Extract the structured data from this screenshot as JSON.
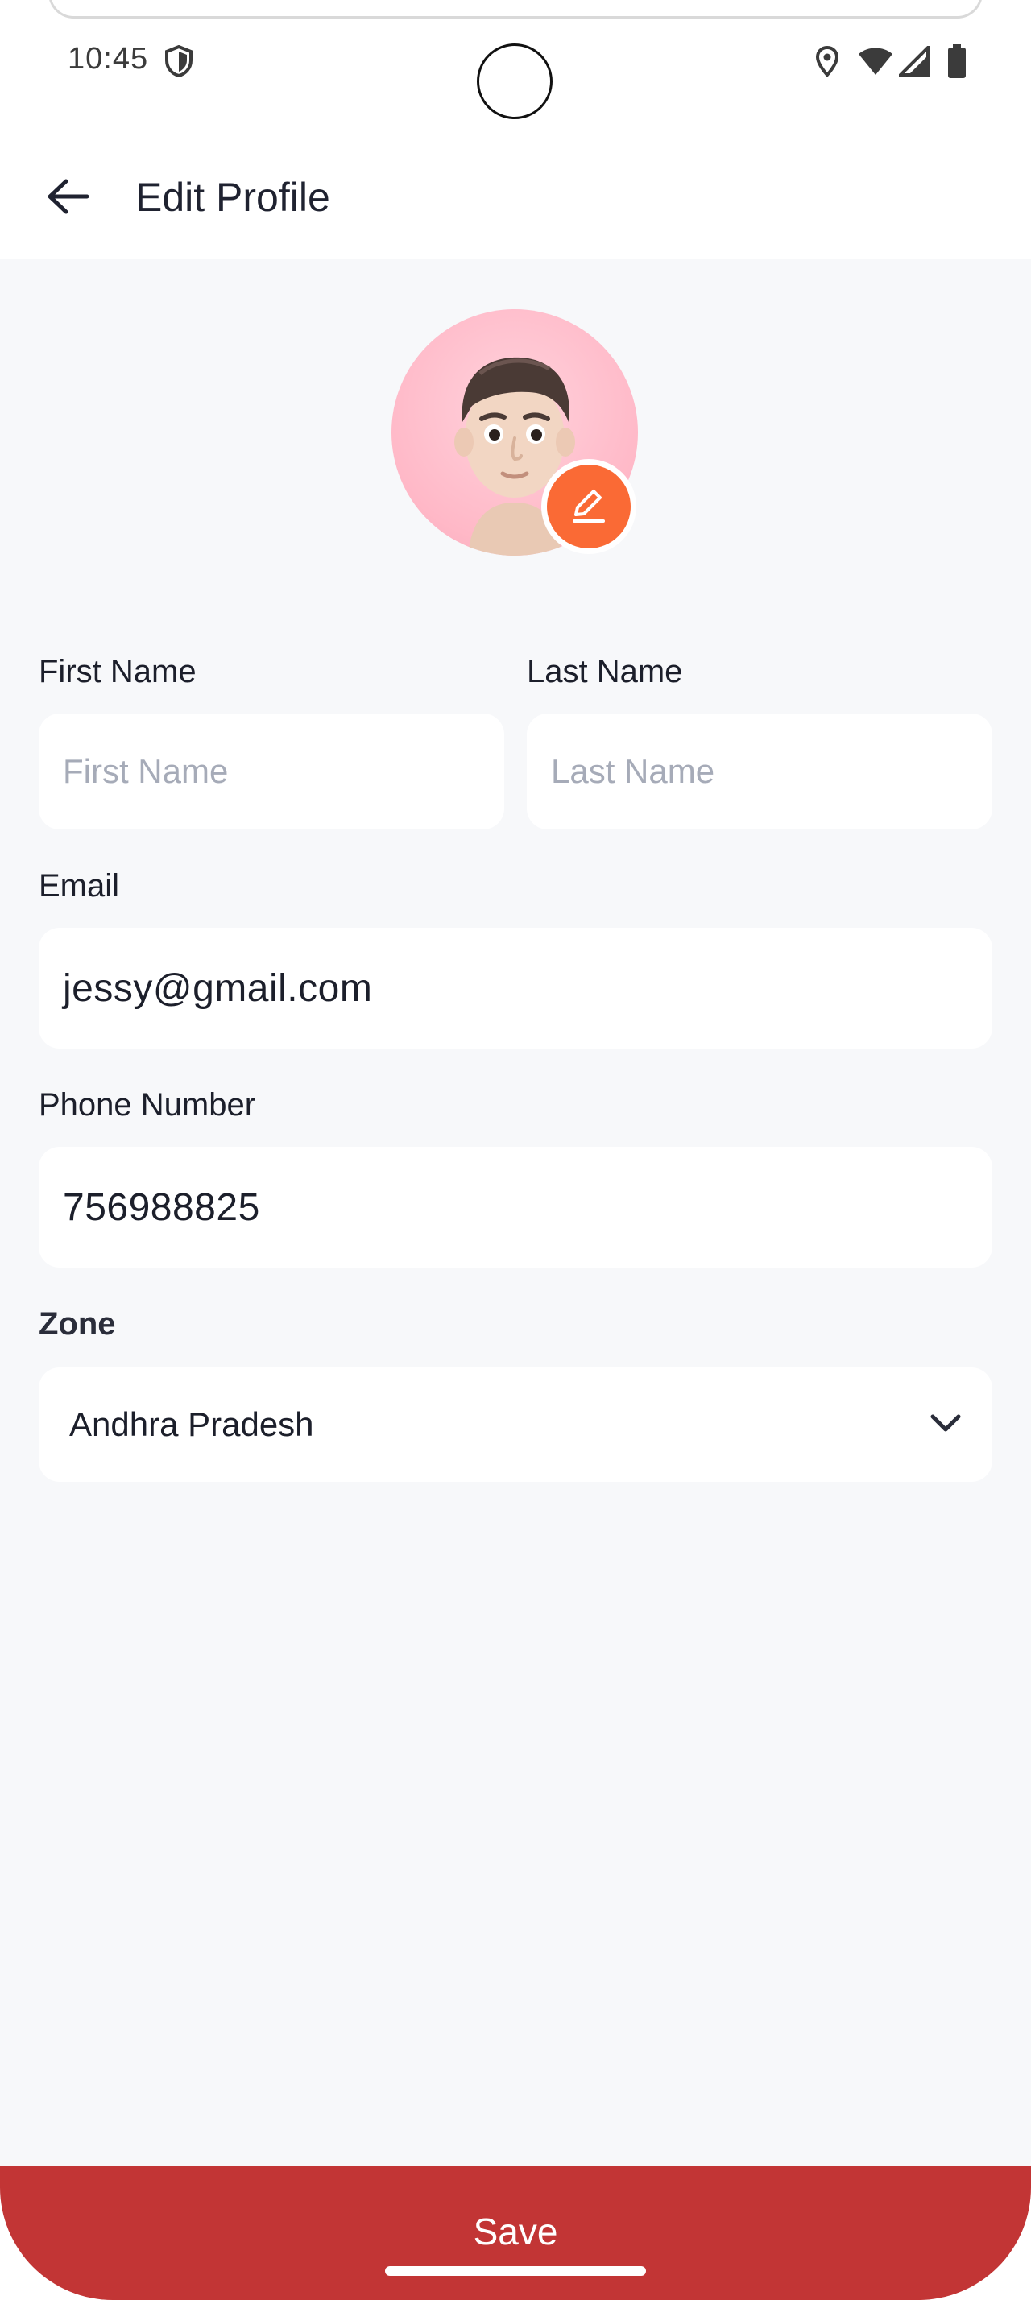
{
  "status_bar": {
    "time": "10:45",
    "icons": [
      "shield-icon",
      "location-icon",
      "wifi-icon",
      "signal-icon",
      "battery-icon"
    ]
  },
  "app_bar": {
    "back_icon": "arrow-left-icon",
    "title": "Edit Profile"
  },
  "profile": {
    "avatar": "memoji-avatar",
    "edit_icon": "pencil-icon",
    "accent_color": "#fa6a35"
  },
  "form": {
    "first_name": {
      "label": "First Name",
      "placeholder": "First Name",
      "value": ""
    },
    "last_name": {
      "label": "Last Name",
      "placeholder": "Last Name",
      "value": ""
    },
    "email": {
      "label": "Email",
      "value": "jessy@gmail.com"
    },
    "phone": {
      "label": "Phone Number",
      "value": "756988825"
    },
    "zone": {
      "label": "Zone",
      "selected": "Andhra Pradesh",
      "icon": "chevron-down-icon"
    }
  },
  "footer": {
    "save_label": "Save",
    "save_color": "#c23535"
  }
}
